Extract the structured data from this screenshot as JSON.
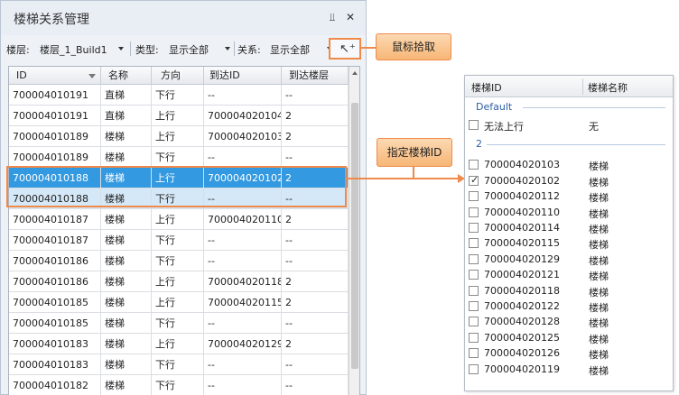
{
  "panel": {
    "title": "楼梯关系管理",
    "pin_glyph": "⫫",
    "close_glyph": "✕"
  },
  "toolbar": {
    "floor_label": "楼层:",
    "floor_value": "楼层_1_Build1",
    "type_label": "类型:",
    "type_value": "显示全部",
    "relation_label": "关系:",
    "relation_value": "显示全部",
    "pick_glyph": "↖⁺"
  },
  "grid": {
    "columns": [
      "ID",
      "名称",
      "方向",
      "到达ID",
      "到达楼层"
    ],
    "rows": [
      [
        "700004010191",
        "直梯",
        "下行",
        "--",
        "--"
      ],
      [
        "700004010191",
        "直梯",
        "上行",
        "700004020104",
        "2"
      ],
      [
        "700004010189",
        "楼梯",
        "上行",
        "700004020103",
        "2"
      ],
      [
        "700004010189",
        "楼梯",
        "下行",
        "--",
        "--"
      ],
      [
        "700004010188",
        "楼梯",
        "上行",
        "700004020102",
        "2"
      ],
      [
        "700004010188",
        "楼梯",
        "下行",
        "--",
        "--"
      ],
      [
        "700004010187",
        "楼梯",
        "上行",
        "700004020110",
        "2"
      ],
      [
        "700004010187",
        "楼梯",
        "下行",
        "--",
        "--"
      ],
      [
        "700004010186",
        "楼梯",
        "下行",
        "--",
        "--"
      ],
      [
        "700004010186",
        "楼梯",
        "上行",
        "700004020118",
        "2"
      ],
      [
        "700004010185",
        "楼梯",
        "上行",
        "700004020115",
        "2"
      ],
      [
        "700004010185",
        "楼梯",
        "下行",
        "--",
        "--"
      ],
      [
        "700004010183",
        "楼梯",
        "上行",
        "700004020129",
        "2"
      ],
      [
        "700004010183",
        "楼梯",
        "下行",
        "--",
        "--"
      ],
      [
        "700004010182",
        "楼梯",
        "下行",
        "--",
        "--"
      ]
    ]
  },
  "callouts": {
    "pick": "鼠标拾取",
    "assign": "指定楼梯ID"
  },
  "popup": {
    "col_id": "楼梯ID",
    "col_name": "楼梯名称",
    "check_glyph": "✓",
    "groups": [
      {
        "label": "Default",
        "items": [
          {
            "id": "无法上行",
            "name": "无",
            "checked": false
          }
        ]
      },
      {
        "label": "2",
        "items": [
          {
            "id": "700004020103",
            "name": "楼梯",
            "checked": false
          },
          {
            "id": "700004020102",
            "name": "楼梯",
            "checked": true
          },
          {
            "id": "700004020112",
            "name": "楼梯",
            "checked": false
          },
          {
            "id": "700004020110",
            "name": "楼梯",
            "checked": false
          },
          {
            "id": "700004020114",
            "name": "楼梯",
            "checked": false
          },
          {
            "id": "700004020115",
            "name": "楼梯",
            "checked": false
          },
          {
            "id": "700004020129",
            "name": "楼梯",
            "checked": false
          },
          {
            "id": "700004020121",
            "name": "楼梯",
            "checked": false
          },
          {
            "id": "700004020118",
            "name": "楼梯",
            "checked": false
          },
          {
            "id": "700004020122",
            "name": "楼梯",
            "checked": false
          },
          {
            "id": "700004020128",
            "name": "楼梯",
            "checked": false
          },
          {
            "id": "700004020125",
            "name": "楼梯",
            "checked": false
          },
          {
            "id": "700004020126",
            "name": "楼梯",
            "checked": false
          },
          {
            "id": "700004020119",
            "name": "楼梯",
            "checked": false
          }
        ]
      }
    ]
  }
}
